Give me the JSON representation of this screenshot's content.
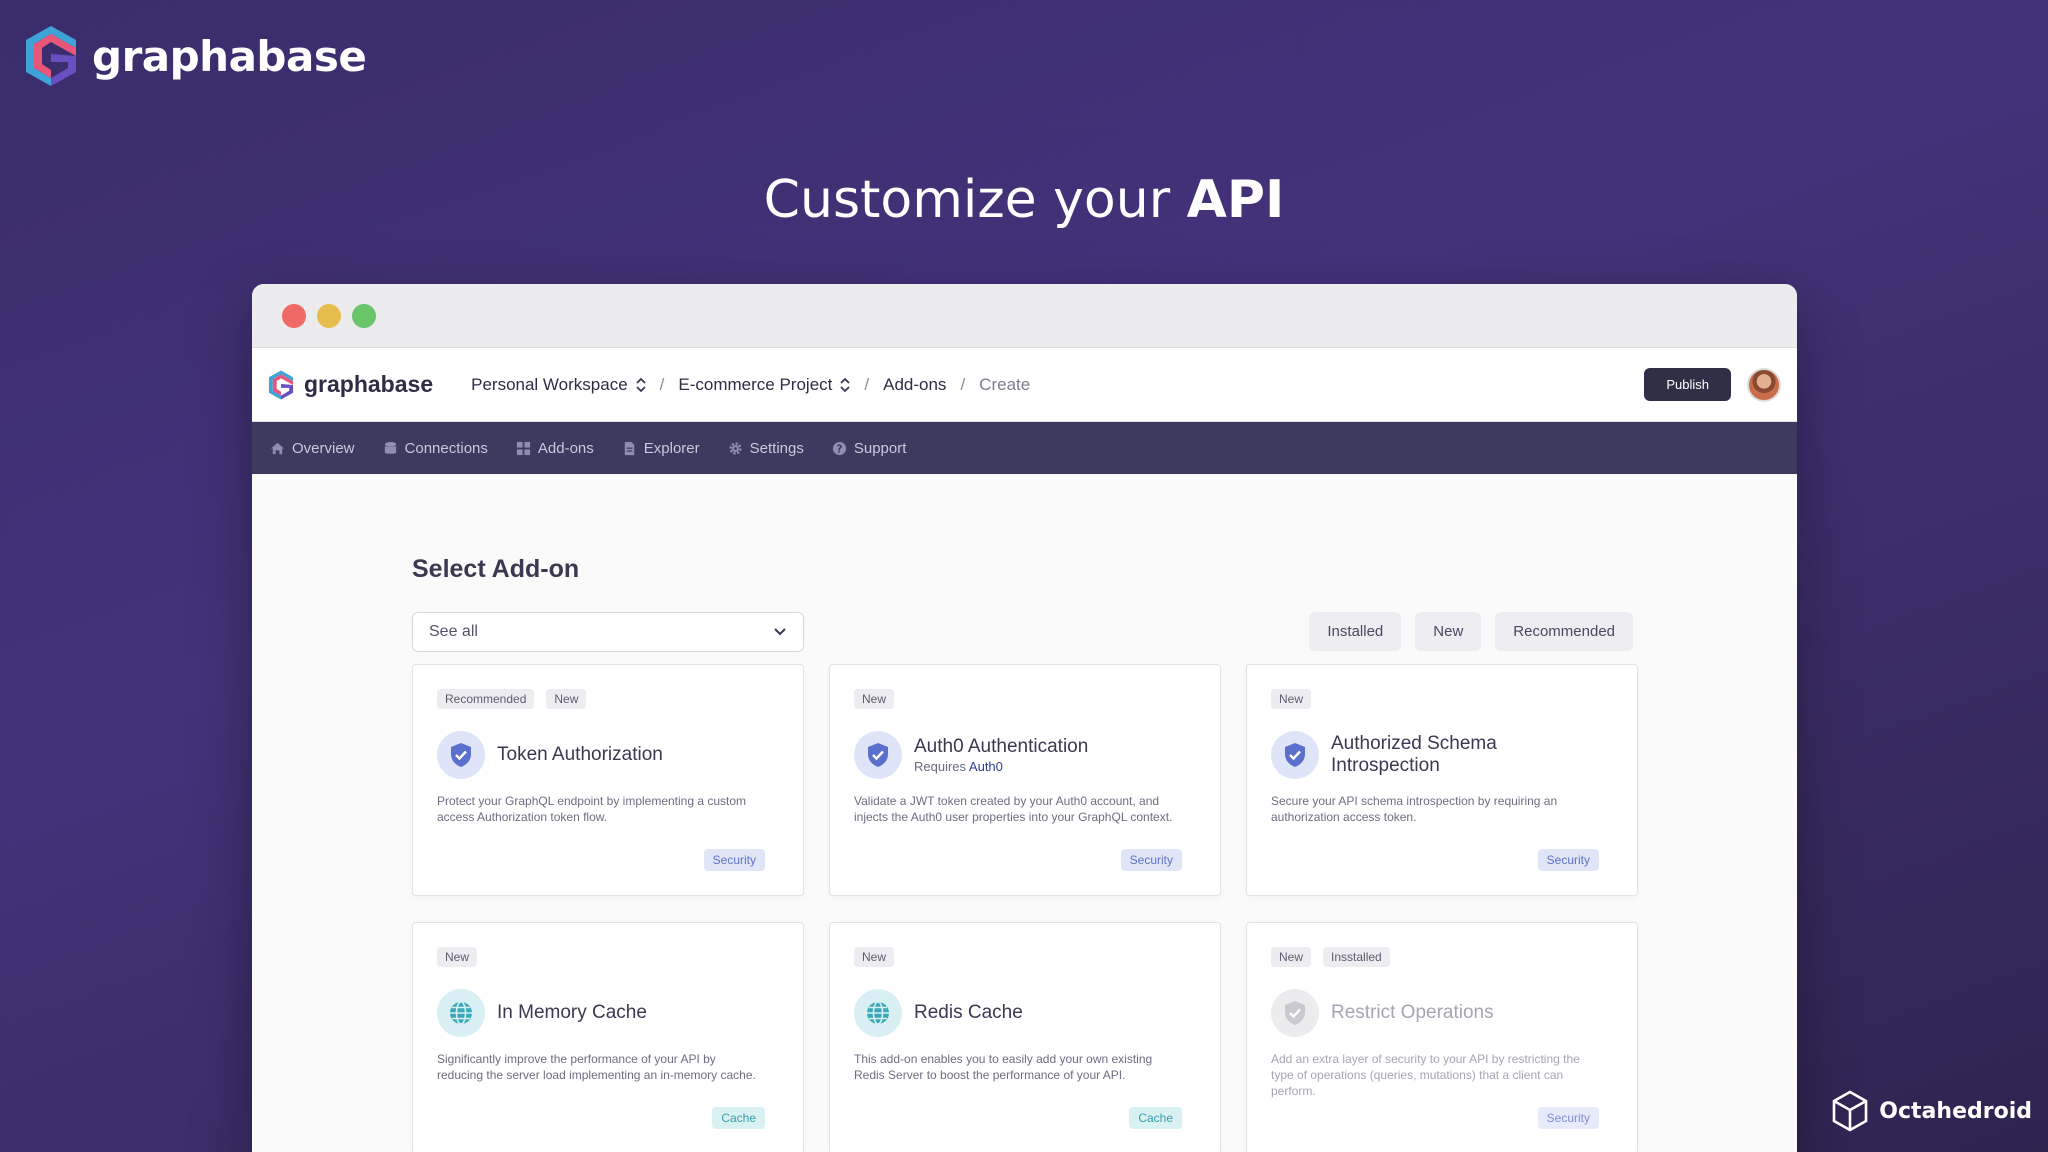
{
  "brand": {
    "name": "graphabase"
  },
  "headline": {
    "prefix": "Customize your",
    "bold": "API"
  },
  "app": {
    "logo_name": "graphabase",
    "breadcrumbs": {
      "workspace": "Personal Workspace",
      "project": "E-commerce Project",
      "section": "Add-ons",
      "current": "Create",
      "separator": "/"
    },
    "publish_label": "Publish"
  },
  "nav": {
    "items": [
      {
        "label": "Overview",
        "icon": "home-icon"
      },
      {
        "label": "Connections",
        "icon": "database-icon"
      },
      {
        "label": "Add-ons",
        "icon": "grid-icon"
      },
      {
        "label": "Explorer",
        "icon": "document-icon"
      },
      {
        "label": "Settings",
        "icon": "gear-icon"
      },
      {
        "label": "Support",
        "icon": "help-icon"
      }
    ]
  },
  "page": {
    "title": "Select Add-on",
    "select": {
      "value": "See all"
    },
    "filters": [
      "Installed",
      "New",
      "Recommended"
    ]
  },
  "cards": [
    {
      "badges": [
        "Recommended",
        "New"
      ],
      "icon": "shield-icon",
      "title": "Token Authorization",
      "sub_prefix": "",
      "sub_link": "",
      "desc": "Protect your GraphQL endpoint by implementing a custom access Authorization token flow.",
      "tag": "Security"
    },
    {
      "badges": [
        "New"
      ],
      "icon": "shield-icon",
      "title": "Auth0 Authentication",
      "sub_prefix": "Requires ",
      "sub_link": "Auth0",
      "desc": "Validate a JWT token created by your Auth0 account, and injects the Auth0 user properties into your GraphQL context.",
      "tag": "Security"
    },
    {
      "badges": [
        "New"
      ],
      "icon": "shield-icon",
      "title": "Authorized Schema Introspection",
      "sub_prefix": "",
      "sub_link": "",
      "desc": "Secure your API schema introspection by requiring an authorization access token.",
      "tag": "Security"
    },
    {
      "badges": [
        "New"
      ],
      "icon": "globe-icon",
      "title": "In Memory Cache",
      "sub_prefix": "",
      "sub_link": "",
      "desc": "Significantly improve the performance of your API by reducing the server load implementing an in-memory cache.",
      "tag": "Cache"
    },
    {
      "badges": [
        "New"
      ],
      "icon": "globe-icon",
      "title": "Redis Cache",
      "sub_prefix": "",
      "sub_link": "",
      "desc": "This add-on enables you to easily add your own existing Redis Server to boost the performance of your API.",
      "tag": "Cache"
    },
    {
      "badges": [
        "New",
        "Insstalled"
      ],
      "icon": "shield-icon",
      "title": "Restrict Operations",
      "sub_prefix": "",
      "sub_link": "",
      "desc": "Add an extra layer of security to your API by restricting the type of operations (queries, mutations) that a client can perform.",
      "tag": "Security"
    }
  ],
  "watermark": {
    "name": "Octahedroid"
  },
  "colors": {
    "nav_bg": "#3c3a5e",
    "publish_bg": "#2f2f48",
    "security_tag": "#5f72c6",
    "cache_tag": "#3a9cac"
  }
}
